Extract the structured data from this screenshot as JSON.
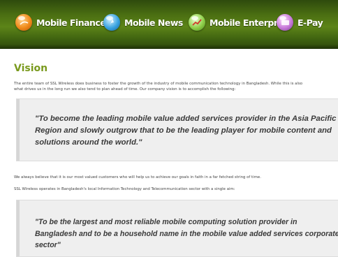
{
  "nav": {
    "items": [
      {
        "label": "Mobile Finance",
        "icon": "finance-globe-icon"
      },
      {
        "label": "Mobile News",
        "icon": "news-globe-icon"
      },
      {
        "label": "Mobile Enterprise",
        "icon": "enterprise-chart-icon"
      },
      {
        "label": "E-Pay",
        "icon": "epay-card-icon"
      }
    ]
  },
  "content": {
    "heading": "Vision",
    "intro_lines": [
      "The entire team of SSL Wireless does business to foster the growth of the industry of mobile communication technology in Bangladesh. While this is also",
      "what drives us in the long run we also tend to plan ahead of time. Our company vision is to accomplish the following:"
    ],
    "quote1_lines": [
      "\"To become the leading mobile value added services provider in the Asia Pacific",
      "Region and slowly outgrow that to be the leading player for mobile content and",
      "solutions around the world.\""
    ],
    "para2": "We always believe that it is our most valued customers who will help us to achieve our goals in faith in a far fetched string of time.",
    "para3": "SSL Wireless operates in Bangladesh's local Information Technology and Telecommunication sector with a single aim:",
    "quote2_lines": [
      "\"To be the largest and most reliable mobile computing solution provider in",
      "Bangladesh and to be a household name in the mobile value added services corporate",
      "sector\""
    ]
  },
  "colors": {
    "nav_green": "#4a6e12",
    "heading_green": "#7a9a1e",
    "quote_bg": "#efefef"
  }
}
